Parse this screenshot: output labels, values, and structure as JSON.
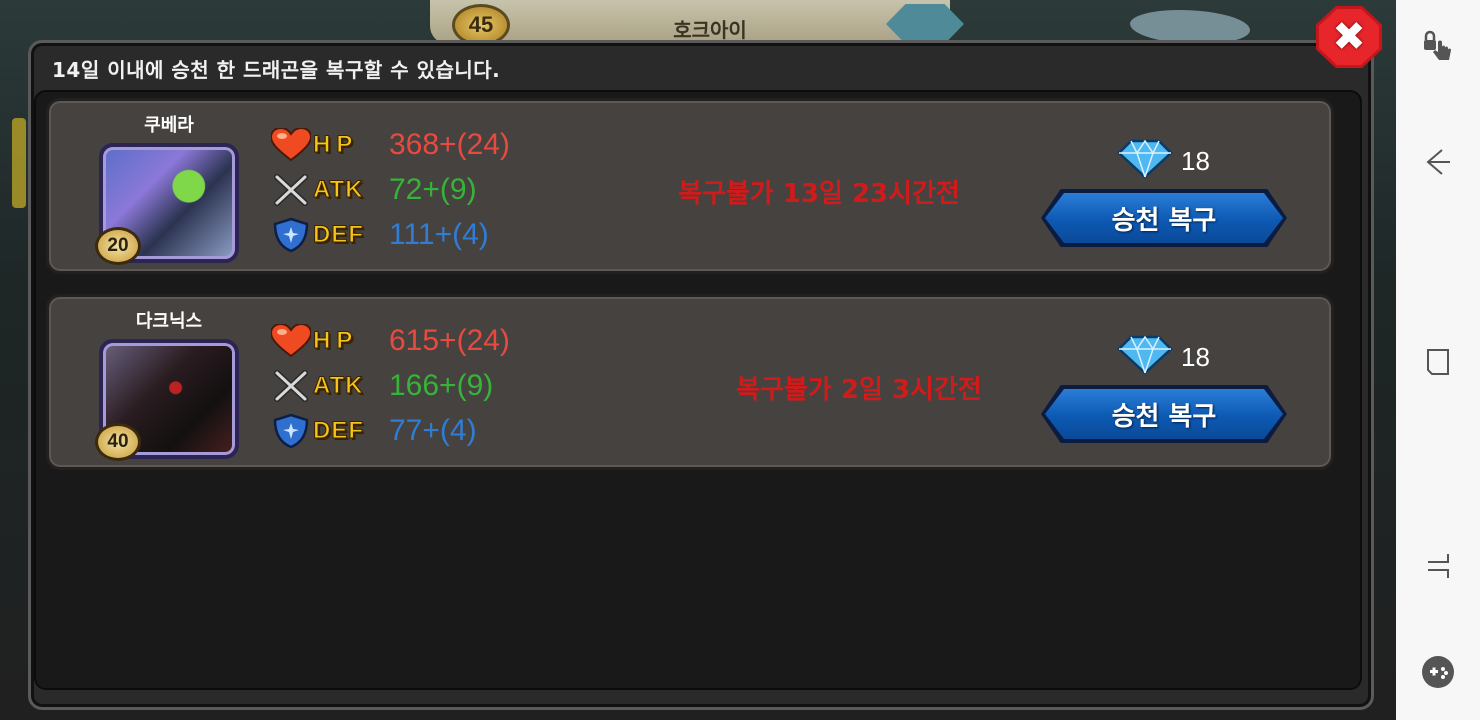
{
  "background": {
    "level": "45",
    "name": "호크아이"
  },
  "modal": {
    "notice": "14일 이내에 승천 한 드래곤을 복구할 수 있습니다.",
    "close_icon": "close-x-icon"
  },
  "dragons": [
    {
      "name": "쿠베라",
      "level": "20",
      "stats": {
        "hp_label": "HP",
        "hp_value": "368+(24)",
        "atk_label": "ATK",
        "atk_value": "72+(9)",
        "def_label": "DEF",
        "def_value": "111+(4)"
      },
      "status": "복구불가 13일 23시간전",
      "gem_cost": "18",
      "button_label": "승천 복구"
    },
    {
      "name": "다크닉스",
      "level": "40",
      "stats": {
        "hp_label": "HP",
        "hp_value": "615+(24)",
        "atk_label": "ATK",
        "atk_value": "166+(9)",
        "def_label": "DEF",
        "def_value": "77+(4)"
      },
      "status": "복구불가 2일 3시간전",
      "gem_cost": "18",
      "button_label": "승천 복구"
    }
  ],
  "colors": {
    "hp": "#e84a40",
    "atk": "#37b339",
    "def": "#2f7dd4",
    "status": "#d11b1b",
    "button": "#0d59b3",
    "close": "#e7262c"
  },
  "system_nav": {
    "icons": [
      "touch-lock-icon",
      "back-icon",
      "recent-apps-icon",
      "home-icon",
      "game-tools-icon"
    ]
  }
}
